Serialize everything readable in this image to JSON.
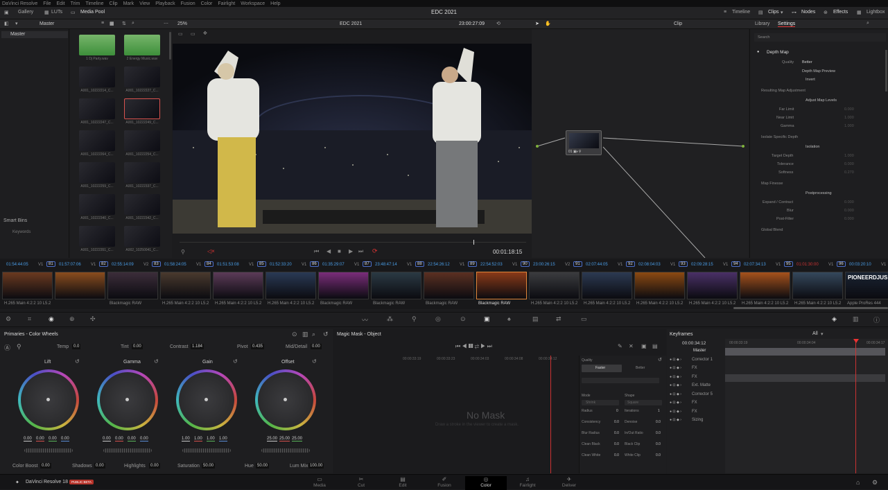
{
  "menubar": {
    "items": [
      "DaVinci Resolve",
      "File",
      "Edit",
      "Trim",
      "Timeline",
      "Clip",
      "Mark",
      "View",
      "Playback",
      "Fusion",
      "Color",
      "Fairlight",
      "Workspace",
      "Help"
    ]
  },
  "topbar": {
    "gallery": "Gallery",
    "luts": "LUTs",
    "media_pool": "Media Pool",
    "project_title": "EDC 2021",
    "timeline": "Timeline",
    "clips": "Clips",
    "nodes": "Nodes",
    "effects": "Effects",
    "lightbox": "Lightbox"
  },
  "secbar": {
    "master": "Master",
    "zoom": "25%",
    "timeline_name": "EDC 2021",
    "timecode": "23:00:27:09",
    "mode": "Clip",
    "library": "Library",
    "settings": "Settings"
  },
  "bins": {
    "master": "Master",
    "smart_bins": "Smart Bins",
    "keywords": "Keywords"
  },
  "media_items": [
    {
      "label": "1 Dj Party.wav"
    },
    {
      "label": "2 Energy Music.wav"
    },
    {
      "label": "A001_10222214_C..."
    },
    {
      "label": "A001_10222227_C..."
    },
    {
      "label": "A001_10222247_C..."
    },
    {
      "label": "A001_10222249_C..."
    },
    {
      "label": "A001_10222264_C..."
    },
    {
      "label": "A001_10222254_C..."
    },
    {
      "label": "A001_10222259_C..."
    },
    {
      "label": "A001_10222337_C..."
    },
    {
      "label": "A001_10222340_C..."
    },
    {
      "label": "A001_10222342_C..."
    },
    {
      "label": "A001_10222351_C..."
    },
    {
      "label": "A002_10250041_C..."
    }
  ],
  "viewer": {
    "timecode": "00:01:18:15"
  },
  "settings_panel": {
    "search": "Search",
    "depth_map": "Depth Map",
    "quality_label": "Quality",
    "quality_value": "Better",
    "depth_map_preview": "Depth Map Preview",
    "invert": "Invert",
    "resulting": "Resulting Map Adjustment",
    "adjust_levels": "Adjust Map Levels",
    "far_limit": "Far Limit",
    "far_limit_v": "0.000",
    "near_limit": "Near Limit",
    "near_limit_v": "1.000",
    "gamma": "Gamma",
    "gamma_v": "1.000",
    "isolate": "Isolate Specific Depth",
    "isolation": "Isolation",
    "target_depth": "Target Depth",
    "target_depth_v": "1.000",
    "tolerance": "Tolerance",
    "tolerance_v": "0.000",
    "softness": "Softness",
    "softness_v": "0.270",
    "map_finesse": "Map Finesse",
    "postprocessing": "Postprocessing",
    "expand": "Expand / Contract",
    "expand_v": "0.000",
    "blur": "Blur",
    "blur_v": "0.000",
    "post_filter": "Post-Filter",
    "post_filter_v": "0.000",
    "global_blend": "Global Blend"
  },
  "timeline_clips": [
    {
      "tc": "01:54:44:05",
      "track": "V1",
      "num": "81",
      "codec": "H.265 Main 4:2:2 10 L5.2"
    },
    {
      "tc": "01:57:07:06",
      "track": "V1",
      "num": "82",
      "codec": ""
    },
    {
      "tc": "02:55:14:09",
      "track": "V2",
      "num": "83",
      "codec": "Blackmagic RAW"
    },
    {
      "tc": "01:58:24:05",
      "track": "V1",
      "num": "84",
      "codec": "H.265 Main 4:2:2 10 L5.2"
    },
    {
      "tc": "01:51:53:08",
      "track": "V1",
      "num": "85",
      "codec": "H.265 Main 4:2:2 10 L5.2"
    },
    {
      "tc": "01:52:33:20",
      "track": "V1",
      "num": "86",
      "codec": "H.265 Main 4:2:2 10 L5.2"
    },
    {
      "tc": "01:35:29:07",
      "track": "V1",
      "num": "87",
      "codec": "Blackmagic RAW"
    },
    {
      "tc": "23:48:47:14",
      "track": "V1",
      "num": "88",
      "codec": "Blackmagic RAW"
    },
    {
      "tc": "22:54:26:12",
      "track": "V1",
      "num": "89",
      "codec": "Blackmagic RAW"
    },
    {
      "tc": "22:54:52:03",
      "track": "V1",
      "num": "90",
      "codec": "Blackmagic RAW"
    },
    {
      "tc": "23:00:26:15",
      "track": "V2",
      "num": "91",
      "codec": "H.265 Main 4:2:2 10 L5.2"
    },
    {
      "tc": "02:07:44:05",
      "track": "V1",
      "num": "92",
      "codec": "H.265 Main 4:2:2 10 L5.2"
    },
    {
      "tc": "02:08:04:03",
      "track": "V1",
      "num": "93",
      "codec": "H.265 Main 4:2:2 10 L5.2"
    },
    {
      "tc": "02:09:28:15",
      "track": "V1",
      "num": "94",
      "codec": "H.265 Main 4:2:2 10 L5.2"
    },
    {
      "tc": "02:07:34:13",
      "track": "V1",
      "num": "95",
      "codec": "H.265 Main 4:2:2 10 L5.2"
    },
    {
      "tc": "01:01:30:00",
      "track": "V1",
      "num": "96",
      "codec": "H.265 Main 4:2:2 10 L5.2"
    },
    {
      "tc": "00:03:20:10",
      "track": "V1",
      "num": "",
      "codec": "Apple ProRes 444"
    }
  ],
  "last_clip_text": "PIONEERDJUS",
  "wheels": {
    "title": "Primaries - Color Wheels",
    "temp_label": "Temp",
    "temp": "0.0",
    "tint_label": "Tint",
    "tint": "0.00",
    "contrast_label": "Contrast",
    "contrast": "1.184",
    "pivot_label": "Pivot",
    "pivot": "0.435",
    "middetail_label": "Mid/Detail",
    "middetail": "0.00",
    "lift": "Lift",
    "gamma": "Gamma",
    "gain": "Gain",
    "offset": "Offset",
    "lift_vals": [
      "0.00",
      "0.00",
      "0.00",
      "0.00"
    ],
    "gamma_vals": [
      "0.00",
      "0.00",
      "0.00",
      "0.00"
    ],
    "gain_vals": [
      "1.00",
      "1.00",
      "1.00",
      "1.00"
    ],
    "offset_vals": [
      "25.00",
      "25.00",
      "25.00"
    ],
    "colorboost_label": "Color Boost",
    "colorboost": "0.00",
    "shadows_label": "Shadows",
    "shadows": "0.00",
    "highlights_label": "Highlights",
    "highlights": "0.00",
    "saturation_label": "Saturation",
    "saturation": "50.00",
    "hue_label": "Hue",
    "hue": "50.00",
    "lummix_label": "Lum Mix",
    "lummix": "100.00"
  },
  "magic_mask": {
    "title": "Magic Mask - Object",
    "no_mask": "No Mask",
    "no_mask_hint": "Draw a stroke in the viewer to create a mask.",
    "quality": "Quality",
    "faster": "Faster",
    "better": "Better",
    "mode": "Mode",
    "mode_v": "Shrink",
    "shape": "Shape",
    "shape_v": "Square",
    "radius": "Radius",
    "radius_v": "0",
    "iterations": "Iterations",
    "iterations_v": "1",
    "consistency": "Consistency",
    "consistency_v": "0.0",
    "denoise": "Denoise",
    "denoise_v": "0.0",
    "blur_radius": "Blur Radius",
    "blur_radius_v": "0.0",
    "inout_ratio": "In/Out Ratio",
    "inout_ratio_v": "0.0",
    "clean_black": "Clean Black",
    "clean_black_v": "0.0",
    "black_clip": "Black Clip",
    "black_clip_v": "0.0",
    "clean_white": "Clean White",
    "clean_white_v": "0.0",
    "white_clip": "White Clip",
    "white_clip_v": "0.0",
    "ruler": [
      "00:00:33:19",
      "00:00:33:23",
      "00:00:34:03",
      "00:00:34:08",
      "00:00:34:12"
    ]
  },
  "keyframes": {
    "title": "Keyframes",
    "filter": "All",
    "timecode": "00:00:34:12",
    "ruler": [
      "00:00:33:19",
      "00:00:34:04",
      "00:00:34:17"
    ],
    "rows": [
      "Master",
      "Corrector 1",
      "FX",
      "FX",
      "Ext. Matte",
      "Corrector 5",
      "FX",
      "FX",
      "Sizing"
    ]
  },
  "pagebar": {
    "brand": "DaVinci Resolve 18",
    "beta": "PUBLIC BETA",
    "tabs": [
      "Media",
      "Cut",
      "Edit",
      "Fusion",
      "Color",
      "Fairlight",
      "Deliver"
    ]
  }
}
